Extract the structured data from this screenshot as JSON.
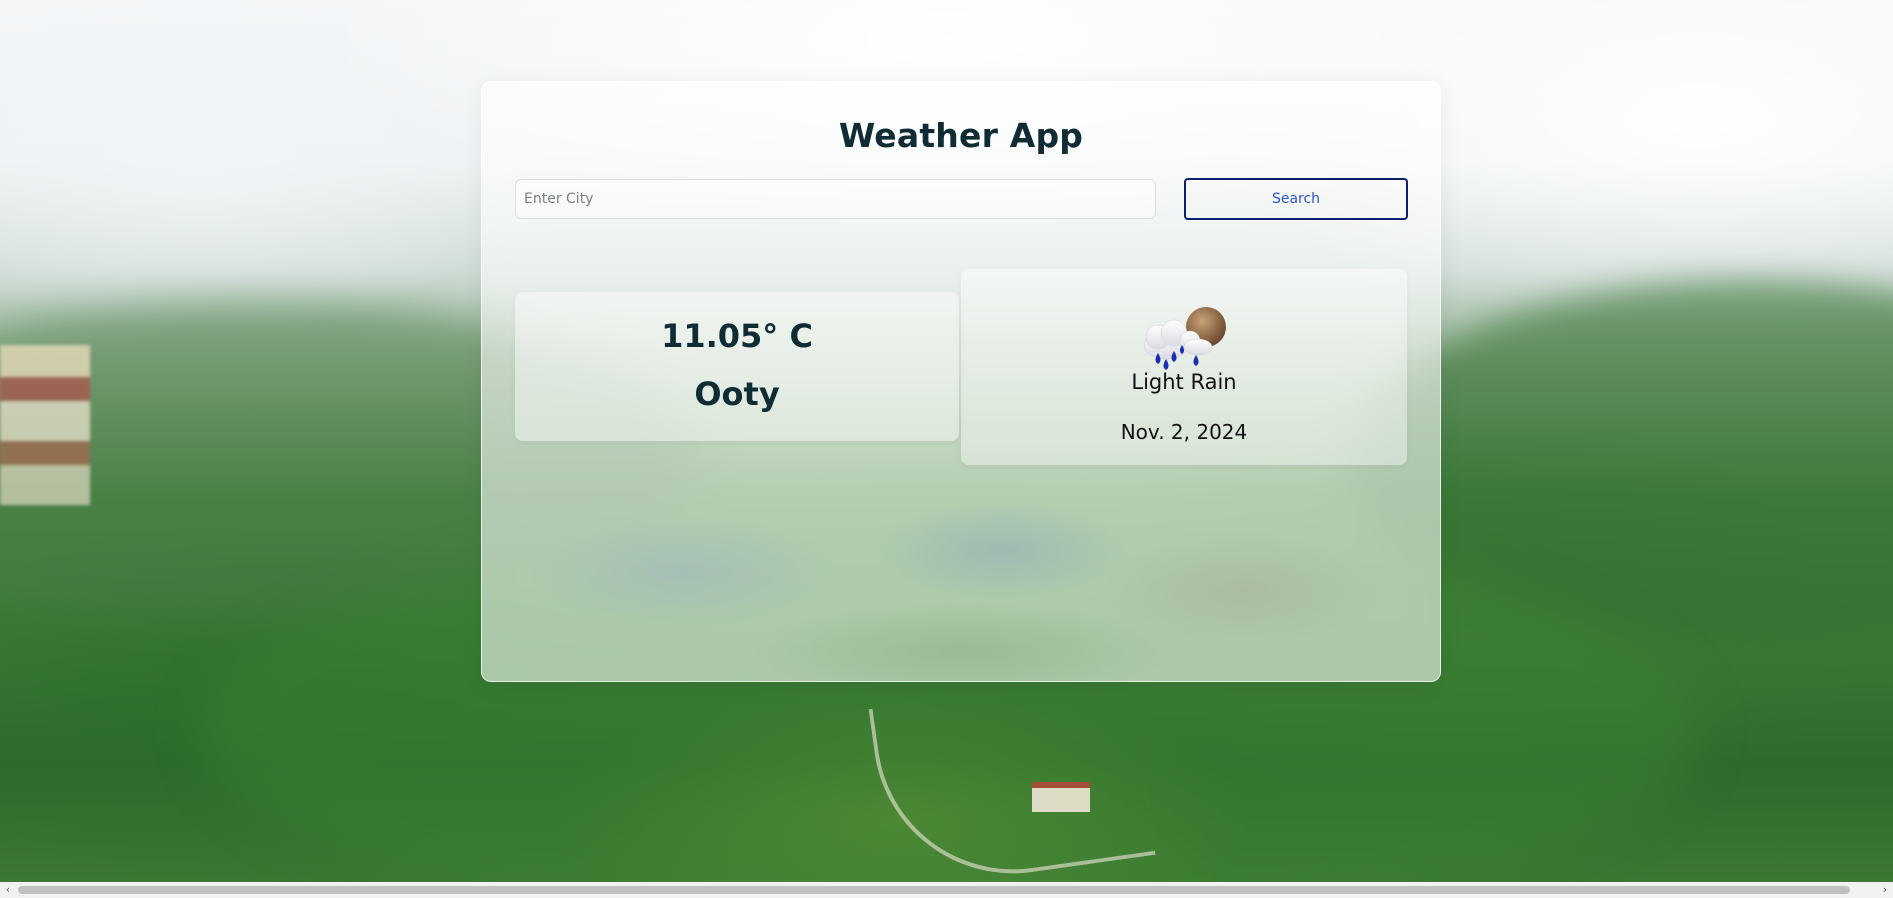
{
  "app": {
    "title": "Weather App"
  },
  "search": {
    "placeholder": "Enter City",
    "value": "",
    "button_label": "Search"
  },
  "weather": {
    "temperature": "11.05° C",
    "city": "Ooty",
    "description": "Light Rain",
    "date": "Nov. 2, 2024",
    "icon": "light-rain-icon"
  },
  "scrollbar": {
    "left_arrow": "‹",
    "right_arrow": "›"
  },
  "colors": {
    "title_text": "#0f2b33",
    "button_border": "#0b1f6e",
    "button_text": "#2e52c9"
  }
}
